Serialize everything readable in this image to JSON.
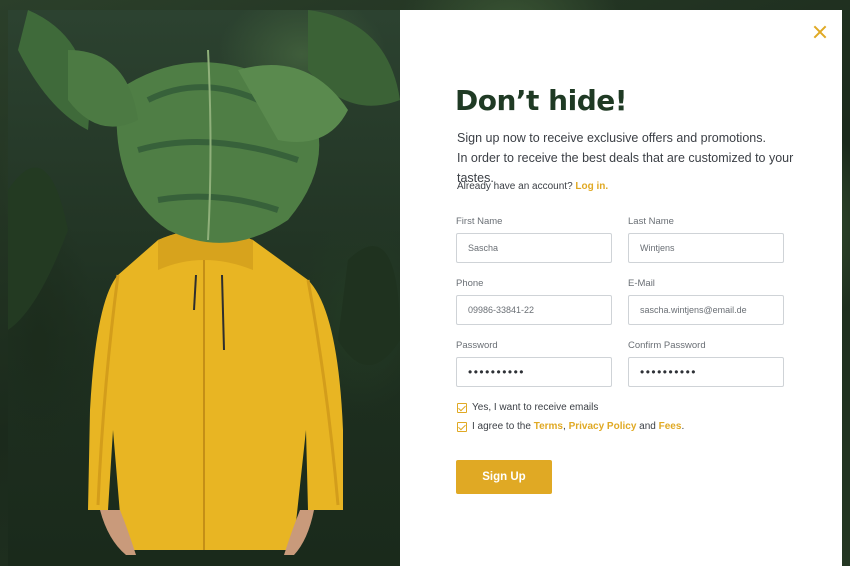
{
  "modal": {
    "title": "Don’t hide!",
    "subtitle_line1": "Sign up now to receive exclusive offers and promotions.",
    "subtitle_line2": "In order to receive the best deals that are customized to your tastes.",
    "login_prompt": "Already have an account?",
    "login_link": "Log in.",
    "fields": {
      "first_name": {
        "label": "First Name",
        "value": "Sascha"
      },
      "last_name": {
        "label": "Last Name",
        "value": "Wintjens"
      },
      "phone": {
        "label": "Phone",
        "value": "09986-33841-22"
      },
      "email": {
        "label": "E-Mail",
        "value": "sascha.wintjens@email.de"
      },
      "password": {
        "label": "Password",
        "value": "••••••••••"
      },
      "confirm_password": {
        "label": "Confirm Password",
        "value": "••••••••••"
      }
    },
    "checkbox_emails": "Yes, I want to receive emails",
    "checkbox_terms_prefix": "I agree to the",
    "terms_link": "Terms",
    "comma": ",",
    "privacy_link": "Privacy Policy",
    "and_text": "and",
    "fees_link": "Fees",
    "period": ".",
    "signup_button": "Sign Up"
  },
  "icons": {
    "close": "close-icon",
    "check": "check-icon"
  },
  "colors": {
    "accent": "#e0a924",
    "title": "#1f3a24",
    "background": "#1d2e1f"
  }
}
